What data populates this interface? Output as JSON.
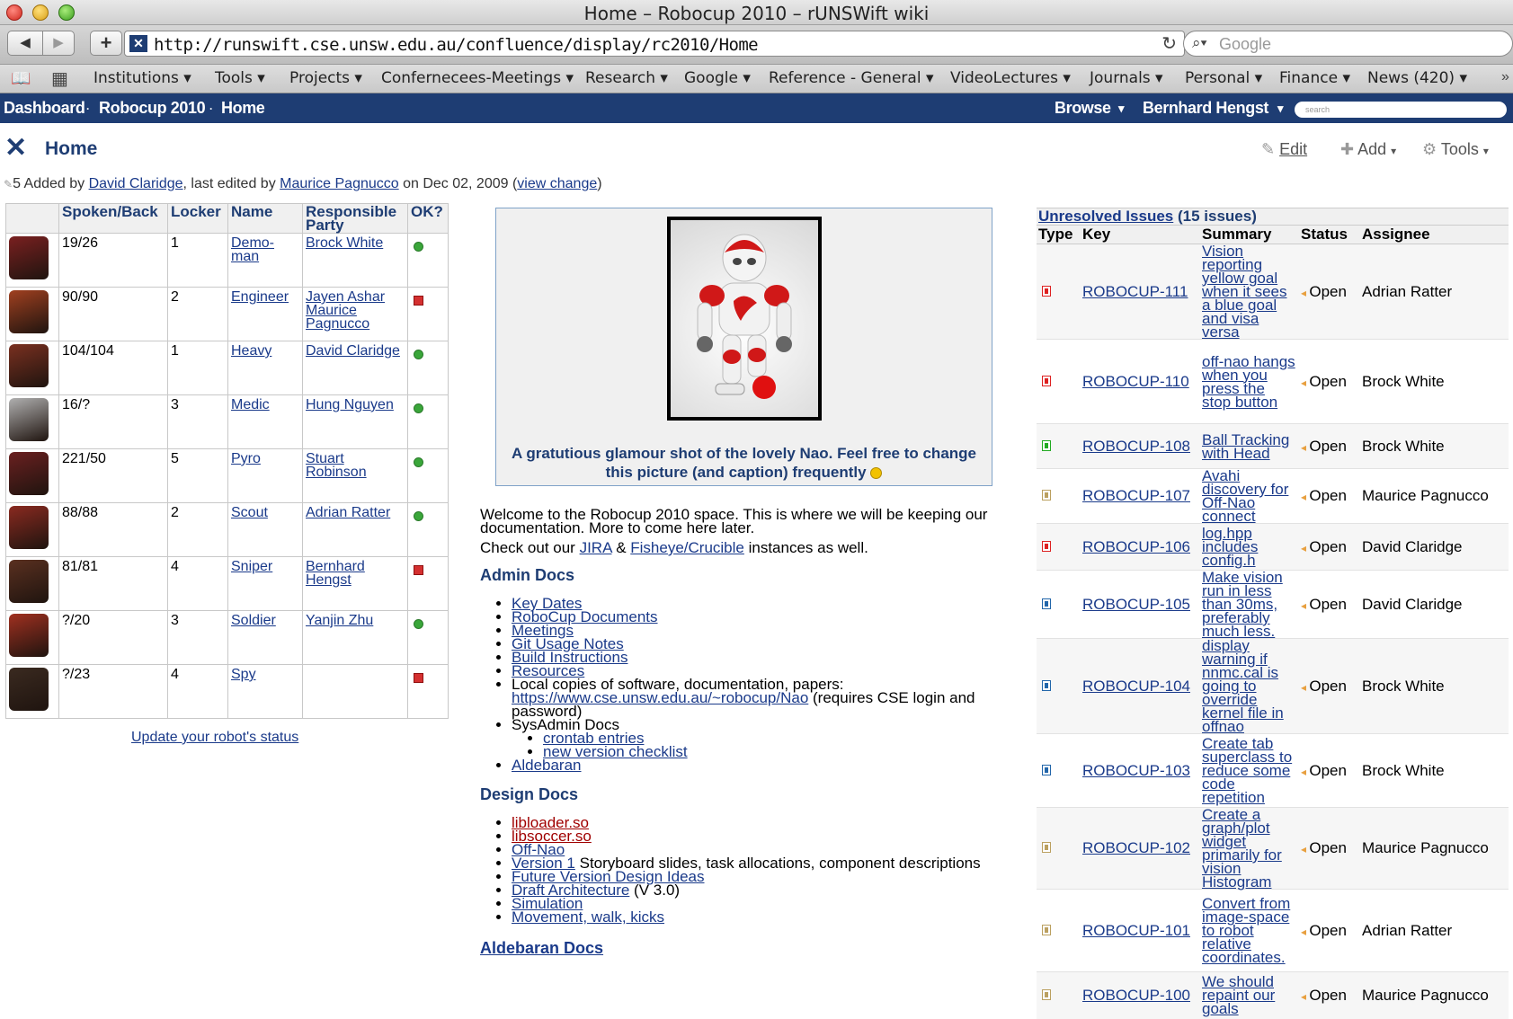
{
  "window": {
    "title": "Home – Robocup 2010 – rUNSWift wiki"
  },
  "toolbar": {
    "back": "◀",
    "forward": "▶",
    "add": "+",
    "url": "http://runswift.cse.unsw.edu.au/confluence/display/rc2010/Home",
    "reload": "↻",
    "search_placeholder": "Google"
  },
  "bookmarks": [
    "Institutions ▾",
    "Tools ▾",
    "Projects ▾",
    "Confernecees-Meetings ▾",
    "Research ▾",
    "Google ▾",
    "Reference - General ▾",
    "VideoLectures ▾",
    "Journals ▾",
    "Personal ▾",
    "Finance ▾",
    "News (420) ▾"
  ],
  "confbar": {
    "dashboard": "Dashboard",
    "space": "Robocup 2010",
    "page": "Home",
    "browse": "Browse",
    "user": "Bernhard Hengst",
    "search_placeholder": "search"
  },
  "page": {
    "title": "Home",
    "edit": "Edit",
    "add": "Add",
    "tools": "Tools",
    "meta_prefix": "5 Added by ",
    "meta_author": "David Claridge",
    "meta_mid": ", last edited by ",
    "meta_editor": "Maurice Pagnucco",
    "meta_date": " on Dec 02, 2009  (",
    "meta_view": "view change",
    "meta_end": ")"
  },
  "robots": {
    "headers": [
      "Spoken/Back",
      "Locker",
      "Name",
      "Responsible Party",
      "OK?"
    ],
    "rows": [
      {
        "spoken": "19/26",
        "locker": "1",
        "name": "Demo-man",
        "party": "Brock White",
        "ok": true
      },
      {
        "spoken": "90/90",
        "locker": "2",
        "name": "Engineer",
        "party": "Jayen Ashar Maurice Pagnucco",
        "ok": false
      },
      {
        "spoken": "104/104",
        "locker": "1",
        "name": "Heavy",
        "party": "David Claridge",
        "ok": true
      },
      {
        "spoken": "16/?",
        "locker": "3",
        "name": "Medic",
        "party": "Hung Nguyen",
        "ok": true
      },
      {
        "spoken": "221/50",
        "locker": "5",
        "name": "Pyro",
        "party": "Stuart Robinson",
        "ok": true
      },
      {
        "spoken": "88/88",
        "locker": "2",
        "name": "Scout",
        "party": "Adrian Ratter",
        "ok": true
      },
      {
        "spoken": "81/81",
        "locker": "4",
        "name": "Sniper",
        "party": "Bernhard Hengst",
        "ok": false
      },
      {
        "spoken": "?/20",
        "locker": "3",
        "name": "Soldier",
        "party": "Yanjin Zhu",
        "ok": true
      },
      {
        "spoken": "?/23",
        "locker": "4",
        "name": "Spy",
        "party": "",
        "ok": false
      }
    ],
    "update_link": "Update your robot's status"
  },
  "image": {
    "caption": "A gratutious glamour shot of the lovely Nao. Feel free to change this picture (and caption) frequently"
  },
  "content": {
    "welcome": "Welcome to the Robocup 2010 space. This is where we will be keeping our documentation. More to come here later.",
    "checkout_pre": "Check out our ",
    "jira": "JIRA",
    "amp": " & ",
    "fisheye": "Fisheye/Crucible",
    "checkout_post": " instances as well.",
    "admin_title": "Admin Docs",
    "admin_items": [
      "Key Dates",
      "RoboCup Documents",
      "Meetings",
      "Git Usage Notes",
      "Build Instructions",
      "Resources"
    ],
    "local_copies": "Local copies of software, documentation, papers:",
    "local_link": "https://www.cse.unsw.edu.au/~robocup/Nao",
    "local_note": " (requires CSE login and password)",
    "sysadmin": "SysAdmin Docs",
    "sysadmin_items": [
      "crontab entries",
      "new version checklist"
    ],
    "aldebaran": "Aldebaran",
    "design_title": "Design Docs",
    "design_red": [
      "libloader.so",
      "libsoccer.so"
    ],
    "offnao": "Off-Nao",
    "version1": "Version 1",
    "version1_note": " Storyboard slides, task allocations, component descriptions",
    "future": "Future Version Design Ideas",
    "draft": "Draft Architecture",
    "draft_note": " (V 3.0)",
    "simulation": "Simulation",
    "movement": "Movement, walk, kicks",
    "aldebaran_title": "Aldebaran Docs"
  },
  "issues": {
    "title": "Unresolved Issues",
    "count": " (15 issues)",
    "headers": [
      "Type",
      "Key",
      "Summary",
      "Status",
      "Assignee"
    ],
    "rows": [
      {
        "key": "ROBOCUP-111",
        "summary": "Vision reporting yellow goal when it sees a blue goal and visa versa",
        "status": "Open",
        "assignee": "Adrian Ratter",
        "type": "bug"
      },
      {
        "key": "ROBOCUP-110",
        "summary": "off-nao hangs when you press the stop button",
        "status": "Open",
        "assignee": "Brock White",
        "type": "bug"
      },
      {
        "key": "ROBOCUP-108",
        "summary": "Ball Tracking with Head",
        "status": "Open",
        "assignee": "Brock White",
        "type": "feature"
      },
      {
        "key": "ROBOCUP-107",
        "summary": "Avahi discovery for Off-Nao connect",
        "status": "Open",
        "assignee": "Maurice Pagnucco",
        "type": "task"
      },
      {
        "key": "ROBOCUP-106",
        "summary": "log.hpp includes config.h",
        "status": "Open",
        "assignee": "David Claridge",
        "type": "bug"
      },
      {
        "key": "ROBOCUP-105",
        "summary": "Make vision run in less than 30ms, preferably much less.",
        "status": "Open",
        "assignee": "David Claridge",
        "type": "improvement"
      },
      {
        "key": "ROBOCUP-104",
        "summary": "display warning if nnmc.cal is going to override kernel file in offnao",
        "status": "Open",
        "assignee": "Brock White",
        "type": "improvement"
      },
      {
        "key": "ROBOCUP-103",
        "summary": "Create tab superclass to reduce some code repetition",
        "status": "Open",
        "assignee": "Brock White",
        "type": "improvement"
      },
      {
        "key": "ROBOCUP-102",
        "summary": "Create a graph/plot widget primarily for vision Histogram",
        "status": "Open",
        "assignee": "Maurice Pagnucco",
        "type": "task"
      },
      {
        "key": "ROBOCUP-101",
        "summary": "Convert from image-space to robot relative coordinates.",
        "status": "Open",
        "assignee": "Adrian Ratter",
        "type": "task"
      },
      {
        "key": "ROBOCUP-100",
        "summary": "We should repaint our goals",
        "status": "Open",
        "assignee": "Maurice Pagnucco",
        "type": "task"
      }
    ]
  }
}
